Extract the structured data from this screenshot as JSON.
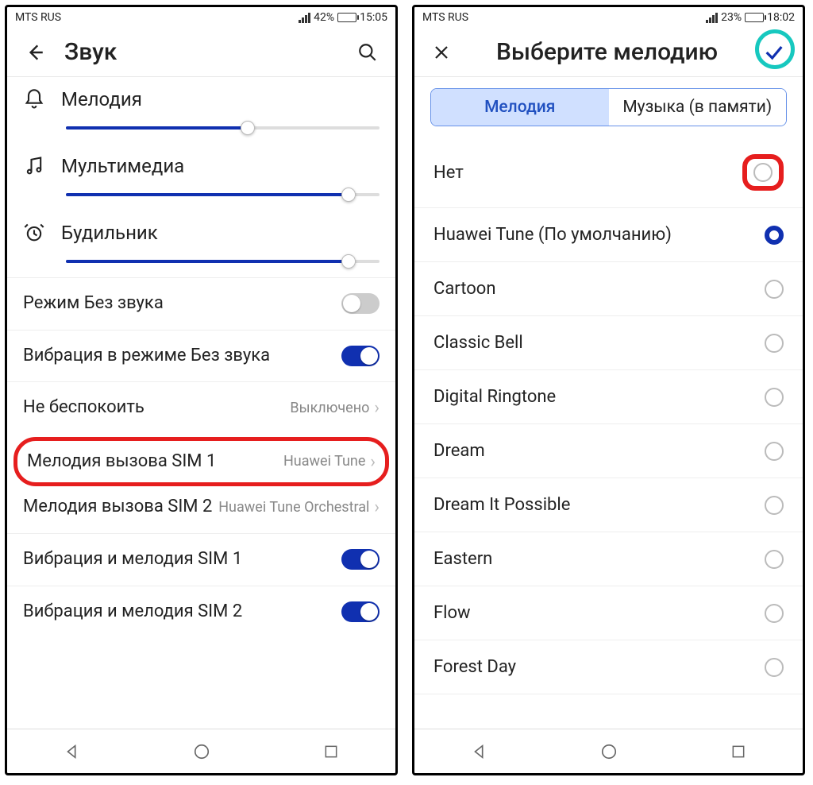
{
  "left": {
    "status": {
      "carrier": "MTS RUS",
      "battery": "42%",
      "time": "15:05",
      "battery_fill": 42
    },
    "title": "Звук",
    "volumes": [
      {
        "label": "Мелодия",
        "percent": 58,
        "icon": "bell"
      },
      {
        "label": "Мультимедиа",
        "percent": 90,
        "icon": "music"
      },
      {
        "label": "Будильник",
        "percent": 90,
        "icon": "alarm"
      }
    ],
    "rows": {
      "silent": "Режим Без звука",
      "vibrate_silent": "Вибрация в режиме Без звука",
      "dnd_label": "Не беспокоить",
      "dnd_value": "Выключено",
      "sim1_label": "Мелодия вызова SIM 1",
      "sim1_value": "Huawei Tune",
      "sim2_label": "Мелодия вызова SIM 2",
      "sim2_value": "Huawei Tune Orchestral",
      "vib_sim1": "Вибрация и мелодия SIM 1",
      "vib_sim2": "Вибрация и мелодия SIM 2"
    }
  },
  "right": {
    "status": {
      "carrier": "MTS RUS",
      "battery": "23%",
      "time": "18:02",
      "battery_fill": 23
    },
    "title": "Выберите мелодию",
    "tabs": {
      "melody": "Мелодия",
      "music": "Музыка (в памяти)"
    },
    "ringtones": [
      {
        "label": "Нет",
        "selected": false,
        "highlight": true
      },
      {
        "label": "Huawei Tune (По умолчанию)",
        "selected": true
      },
      {
        "label": "Cartoon",
        "selected": false
      },
      {
        "label": "Classic Bell",
        "selected": false
      },
      {
        "label": "Digital Ringtone",
        "selected": false
      },
      {
        "label": "Dream",
        "selected": false
      },
      {
        "label": "Dream It Possible",
        "selected": false
      },
      {
        "label": "Eastern",
        "selected": false
      },
      {
        "label": "Flow",
        "selected": false
      },
      {
        "label": "Forest Day",
        "selected": false
      }
    ]
  }
}
